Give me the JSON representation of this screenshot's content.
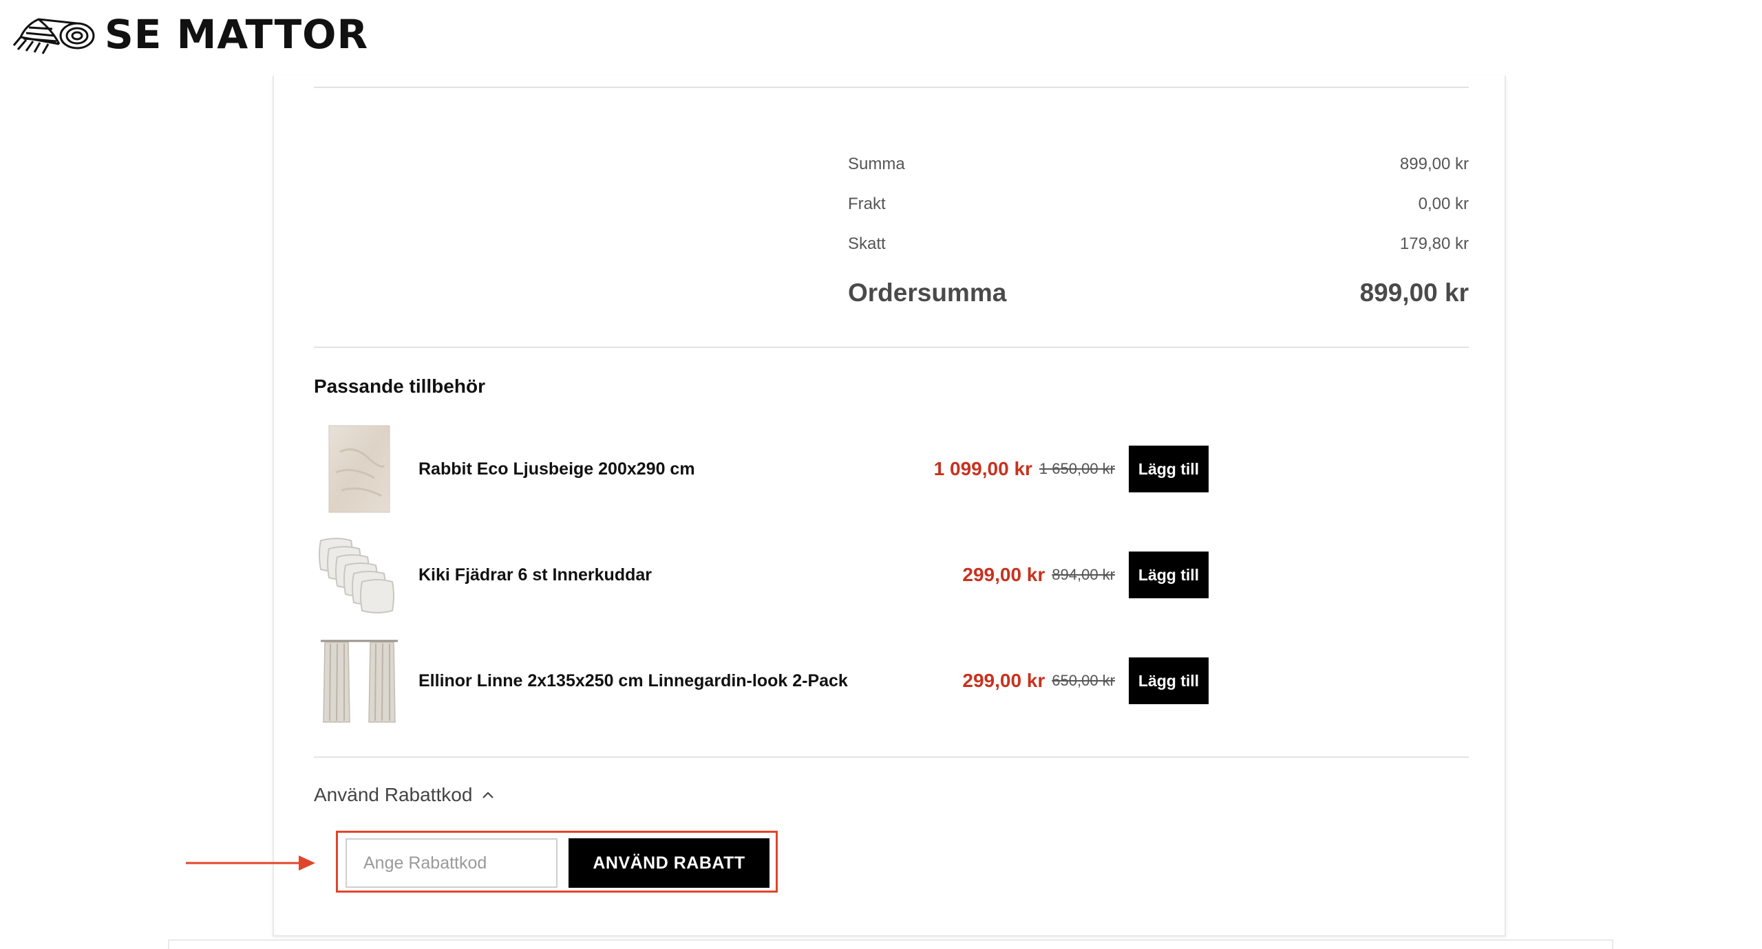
{
  "brand": {
    "name": "SE MATTOR"
  },
  "summary": {
    "rows": [
      {
        "label": "Summa",
        "value": "899,00 kr"
      },
      {
        "label": "Frakt",
        "value": "0,00 kr"
      },
      {
        "label": "Skatt",
        "value": "179,80 kr"
      }
    ],
    "total_label": "Ordersumma",
    "total_value": "899,00 kr"
  },
  "accessories": {
    "title": "Passande tillbehör",
    "items": [
      {
        "name": "Rabbit Eco Ljusbeige 200x290 cm",
        "price": "1 099,00 kr",
        "old_price": "1 650,00 kr",
        "button": "Lägg till"
      },
      {
        "name": "Kiki Fjädrar 6 st Innerkuddar",
        "price": "299,00 kr",
        "old_price": "894,00 kr",
        "button": "Lägg till"
      },
      {
        "name": "Ellinor Linne 2x135x250 cm Linnegardin-look 2-Pack",
        "price": "299,00 kr",
        "old_price": "650,00 kr",
        "button": "Lägg till"
      }
    ]
  },
  "discount": {
    "toggle_label": "Använd Rabattkod",
    "placeholder": "Ange Rabattkod",
    "value": "",
    "button": "ANVÄND RABATT"
  },
  "colors": {
    "sale": "#c8321e",
    "highlight": "#e0452b",
    "button": "#000000"
  },
  "icons": {
    "logo": "rolled-rug-logo-icon",
    "toggle": "chevron-up-icon",
    "annotation": "arrow-right-icon"
  }
}
